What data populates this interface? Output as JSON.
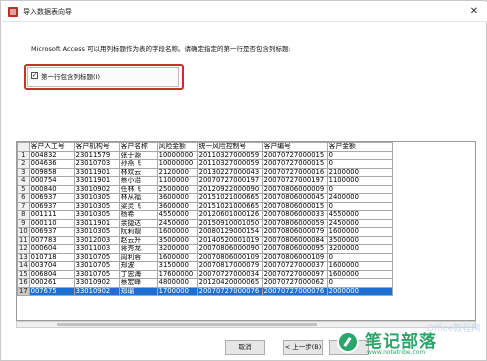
{
  "window": {
    "title": "导入数据表向导",
    "close_glyph": "✕"
  },
  "description": "Microsoft Access 可以用列标题作为表的字段名称。请确定指定的第一行是否包含列标题:",
  "first_row_option": {
    "label": "第一行包含列标题(I)",
    "checked": true,
    "check_glyph": "✓"
  },
  "grid": {
    "columns": [
      "客户人工号",
      "客户机构号",
      "客户名称",
      "风险金额",
      "统一风险控制号",
      "客户编号",
      "客户金额"
    ],
    "rows": [
      [
        "1",
        "004832",
        "23011579",
        "张于源",
        "10000000",
        "20110327000059",
        "20070727000015",
        "0"
      ],
      [
        "2",
        "004636",
        "23010703",
        "孙燕飞",
        "10000000",
        "20110327000059",
        "20070727000015",
        "0"
      ],
      [
        "3",
        "009858",
        "33011901",
        "林欢云",
        "2120000",
        "20130227000043",
        "20070727000016",
        "2100000"
      ],
      [
        "4",
        "000754",
        "33011901",
        "蔡小治",
        "1100000",
        "20070727000197",
        "20070727000197",
        "1100000"
      ],
      [
        "5",
        "000840",
        "33010902",
        "任林飞",
        "2500000",
        "20120922000090",
        "20070806000009",
        "0"
      ],
      [
        "6",
        "006937",
        "33010305",
        "林从福",
        "3600000",
        "20151021000665",
        "20070806000045",
        "2400000"
      ],
      [
        "7",
        "006937",
        "33010305",
        "梁灵飞",
        "3600000",
        "20151021000665",
        "20070806000015",
        "0"
      ],
      [
        "8",
        "001111",
        "33010305",
        "杨希",
        "4550000",
        "20120601000126",
        "20070806000033",
        "4550000"
      ],
      [
        "9",
        "000110",
        "33011901",
        "余捷达",
        "2450000",
        "20150910001050",
        "20070806000059",
        "2450000"
      ],
      [
        "10",
        "006937",
        "33010305",
        "阮莉靓",
        "1600000",
        "20080129000154",
        "20070806000079",
        "1600000"
      ],
      [
        "11",
        "007783",
        "33012003",
        "赵云升",
        "3500000",
        "20140520001019",
        "20070806000084",
        "3500000"
      ],
      [
        "12",
        "000604",
        "33011003",
        "蒋秀龙",
        "3200000",
        "20070806000090",
        "20070806000095",
        "3200000"
      ],
      [
        "13",
        "010718",
        "33010705",
        "周利蓉",
        "1600000",
        "20070806000109",
        "20070806000109",
        "0"
      ],
      [
        "14",
        "003704",
        "33010705",
        "郑波",
        "3150000",
        "20070817000079",
        "20070727000037",
        "1600000"
      ],
      [
        "15",
        "006804",
        "33010705",
        "丁忠海",
        "17600000",
        "20070727000034",
        "20070727000097",
        "1600000"
      ],
      [
        "16",
        "000261",
        "33010902",
        "蔡宏峰",
        "4800000",
        "20120420000065",
        "20070727000062",
        "0"
      ],
      [
        "17",
        "007675",
        "33010902",
        "郑瑜",
        "1700000",
        "20070727000076",
        "20070727000076",
        "2000000"
      ]
    ],
    "selected_row_index": 16
  },
  "buttons": {
    "cancel": "取消",
    "back": "< 上一步(B)",
    "next": "下一步"
  },
  "watermark": {
    "text": "笔记部落",
    "url": "www.notetribe.com",
    "faint": "Office教程网"
  },
  "colors": {
    "highlight_border": "#c8302c",
    "selection": "#1f6fd1",
    "watermark_green": "#2ca56a"
  }
}
